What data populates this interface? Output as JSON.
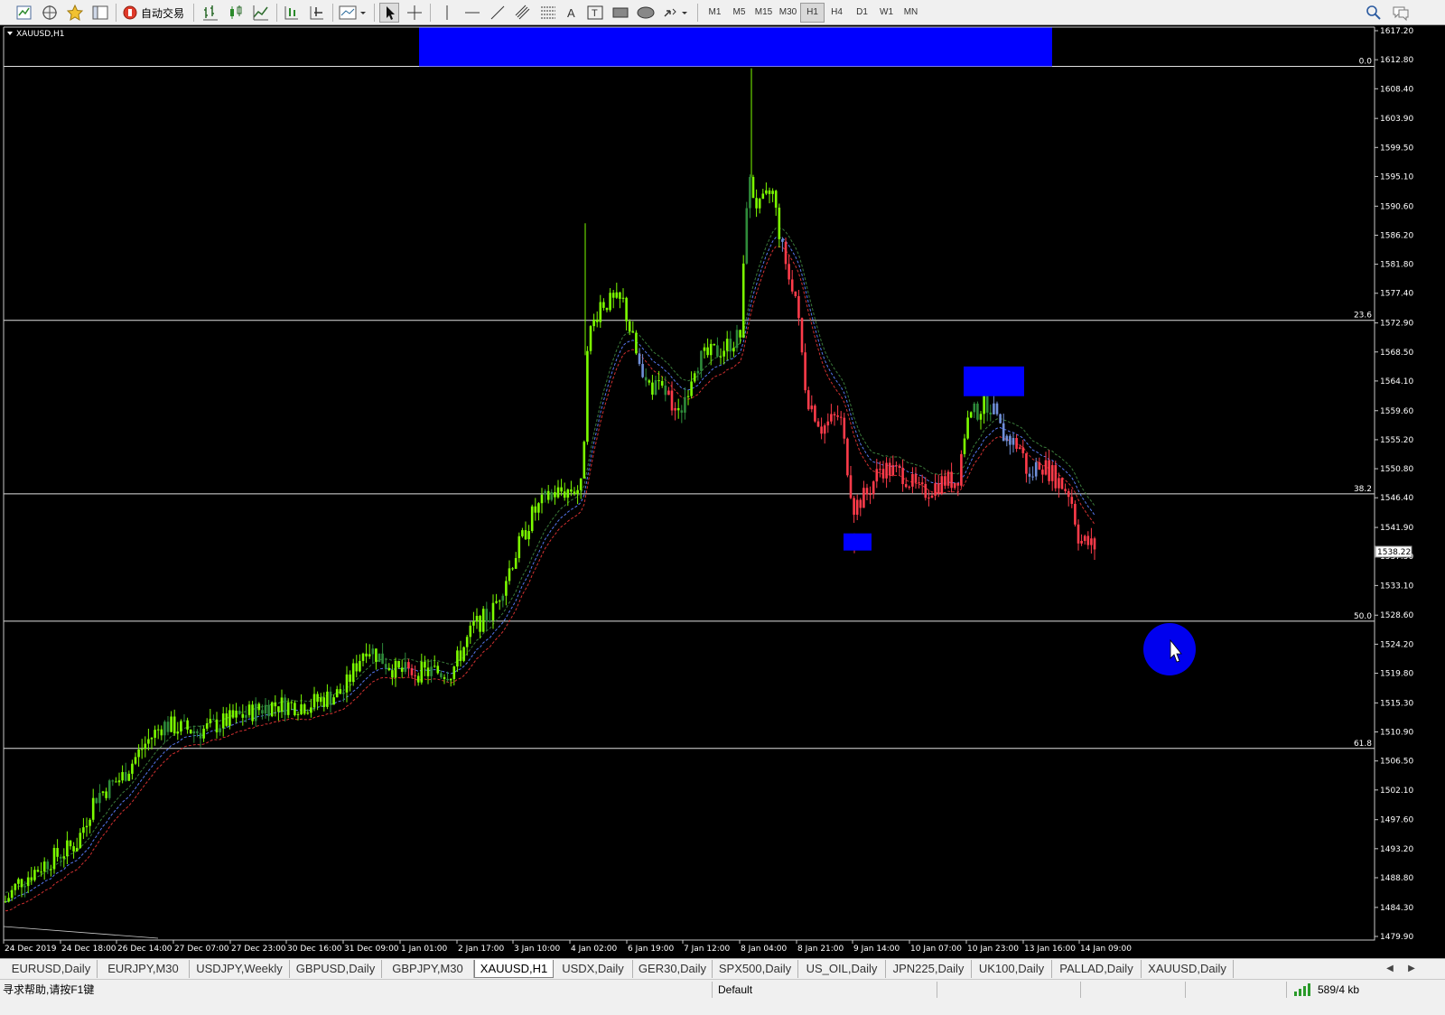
{
  "toolbar": {
    "auto_trade_label": "自动交易",
    "timeframes": [
      "M1",
      "M5",
      "M15",
      "M30",
      "H1",
      "H4",
      "D1",
      "W1",
      "MN"
    ],
    "active_timeframe": "H1"
  },
  "chart": {
    "symbol_title": "XAUUSD,H1",
    "current_price_label": "1538.22",
    "price_ticks": [
      "1617.20",
      "1612.80",
      "1608.40",
      "1603.90",
      "1599.50",
      "1595.10",
      "1590.60",
      "1586.20",
      "1581.80",
      "1577.40",
      "1572.90",
      "1568.50",
      "1564.10",
      "1559.60",
      "1555.20",
      "1550.80",
      "1546.40",
      "1541.90",
      "1537.50",
      "1533.10",
      "1528.60",
      "1524.20",
      "1519.80",
      "1515.30",
      "1510.90",
      "1506.50",
      "1502.10",
      "1497.60",
      "1493.20",
      "1488.80",
      "1484.30",
      "1479.90"
    ],
    "time_ticks": [
      "24 Dec 2019",
      "24 Dec 18:00",
      "26 Dec 14:00",
      "27 Dec 07:00",
      "27 Dec 23:00",
      "30 Dec 16:00",
      "31 Dec 09:00",
      "1 Jan 01:00",
      "2 Jan 17:00",
      "3 Jan 10:00",
      "4 Jan 02:00",
      "6 Jan 19:00",
      "7 Jan 12:00",
      "8 Jan 04:00",
      "8 Jan 21:00",
      "9 Jan 14:00",
      "10 Jan 07:00",
      "10 Jan 23:00",
      "13 Jan 16:00",
      "14 Jan 09:00"
    ],
    "fib_levels": [
      {
        "label": "0.0",
        "price": 1611.8
      },
      {
        "label": "23.6",
        "price": 1573.3
      },
      {
        "label": "38.2",
        "price": 1547.0
      },
      {
        "label": "50.0",
        "price": 1527.7
      },
      {
        "label": "61.8",
        "price": 1508.4
      }
    ],
    "colors": {
      "bull_candle": "#7cfc00",
      "bull_candle_dark": "#2e8b3a",
      "bear_candle": "#ff3b4a",
      "neutral_candle": "#6f8fd8",
      "highlight_box": "#0000ff",
      "ma_upper": "#3a7a3a",
      "ma_mid": "#5577ee",
      "ma_lower": "#d03030",
      "fib_line": "#e0e0e0"
    },
    "cursor": "pointer-cursor-icon"
  },
  "tabs": [
    "EURUSD,Daily",
    "EURJPY,M30",
    "USDJPY,Weekly",
    "GBPUSD,Daily",
    "GBPJPY,M30",
    "XAUUSD,H1",
    "USDX,Daily",
    "GER30,Daily",
    "SPX500,Daily",
    "US_OIL,Daily",
    "JPN225,Daily",
    "UK100,Daily",
    "PALLAD,Daily",
    "XAUUSD,Daily"
  ],
  "active_tab": "XAUUSD,H1",
  "status": {
    "help_text": "寻求帮助,请按F1键",
    "profile": "Default",
    "traffic": "589/4 kb"
  }
}
